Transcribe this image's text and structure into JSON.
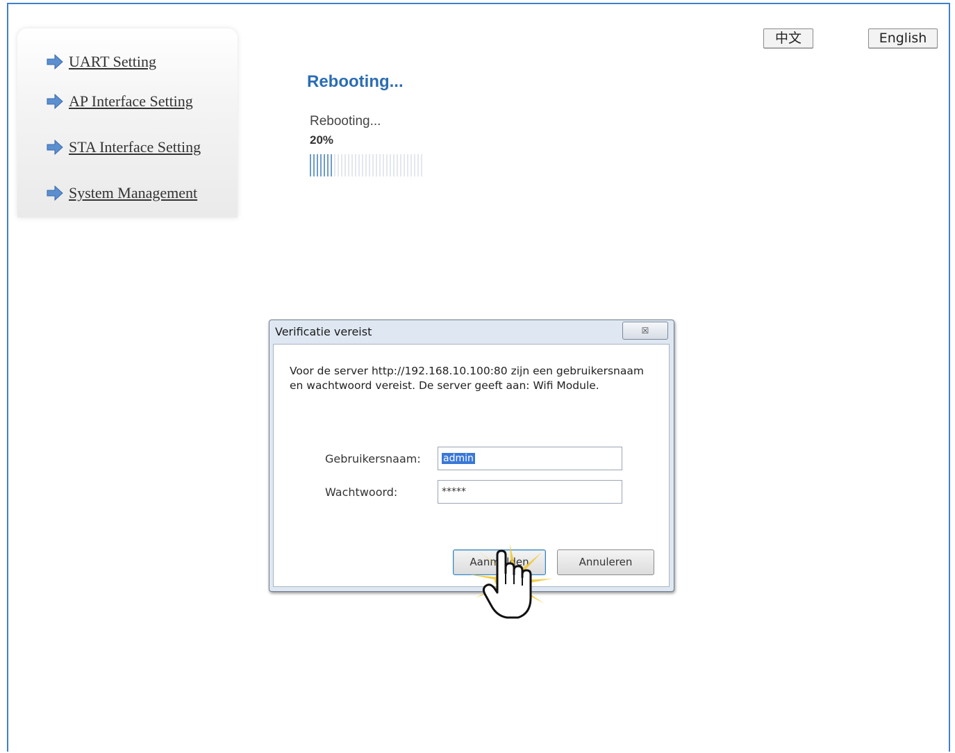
{
  "language_buttons": {
    "chinese": "中文",
    "english": "English"
  },
  "sidebar": {
    "items": [
      {
        "label": "UART Setting"
      },
      {
        "label": "AP Interface Setting"
      },
      {
        "label": "STA Interface Setting"
      },
      {
        "label": "System Management"
      }
    ]
  },
  "main": {
    "title": "Rebooting...",
    "status_text": "Rebooting...",
    "progress_label": "20%",
    "progress_fraction": 0.2
  },
  "dialog": {
    "title": "Verificatie vereist",
    "close_glyph": "☒",
    "message": "Voor de server http://192.168.10.100:80 zijn een gebruikersnaam en wachtwoord vereist. De server geeft aan: Wifi Module.",
    "username_label": "Gebruikersnaam:",
    "username_value": "admin",
    "password_label": "Wachtwoord:",
    "password_value": "*****",
    "ok_label": "Aanmelden",
    "cancel_label": "Annuleren"
  },
  "colors": {
    "accent": "#2b6db3",
    "frame": "#3f7fd0",
    "selection": "#3a78d8"
  }
}
